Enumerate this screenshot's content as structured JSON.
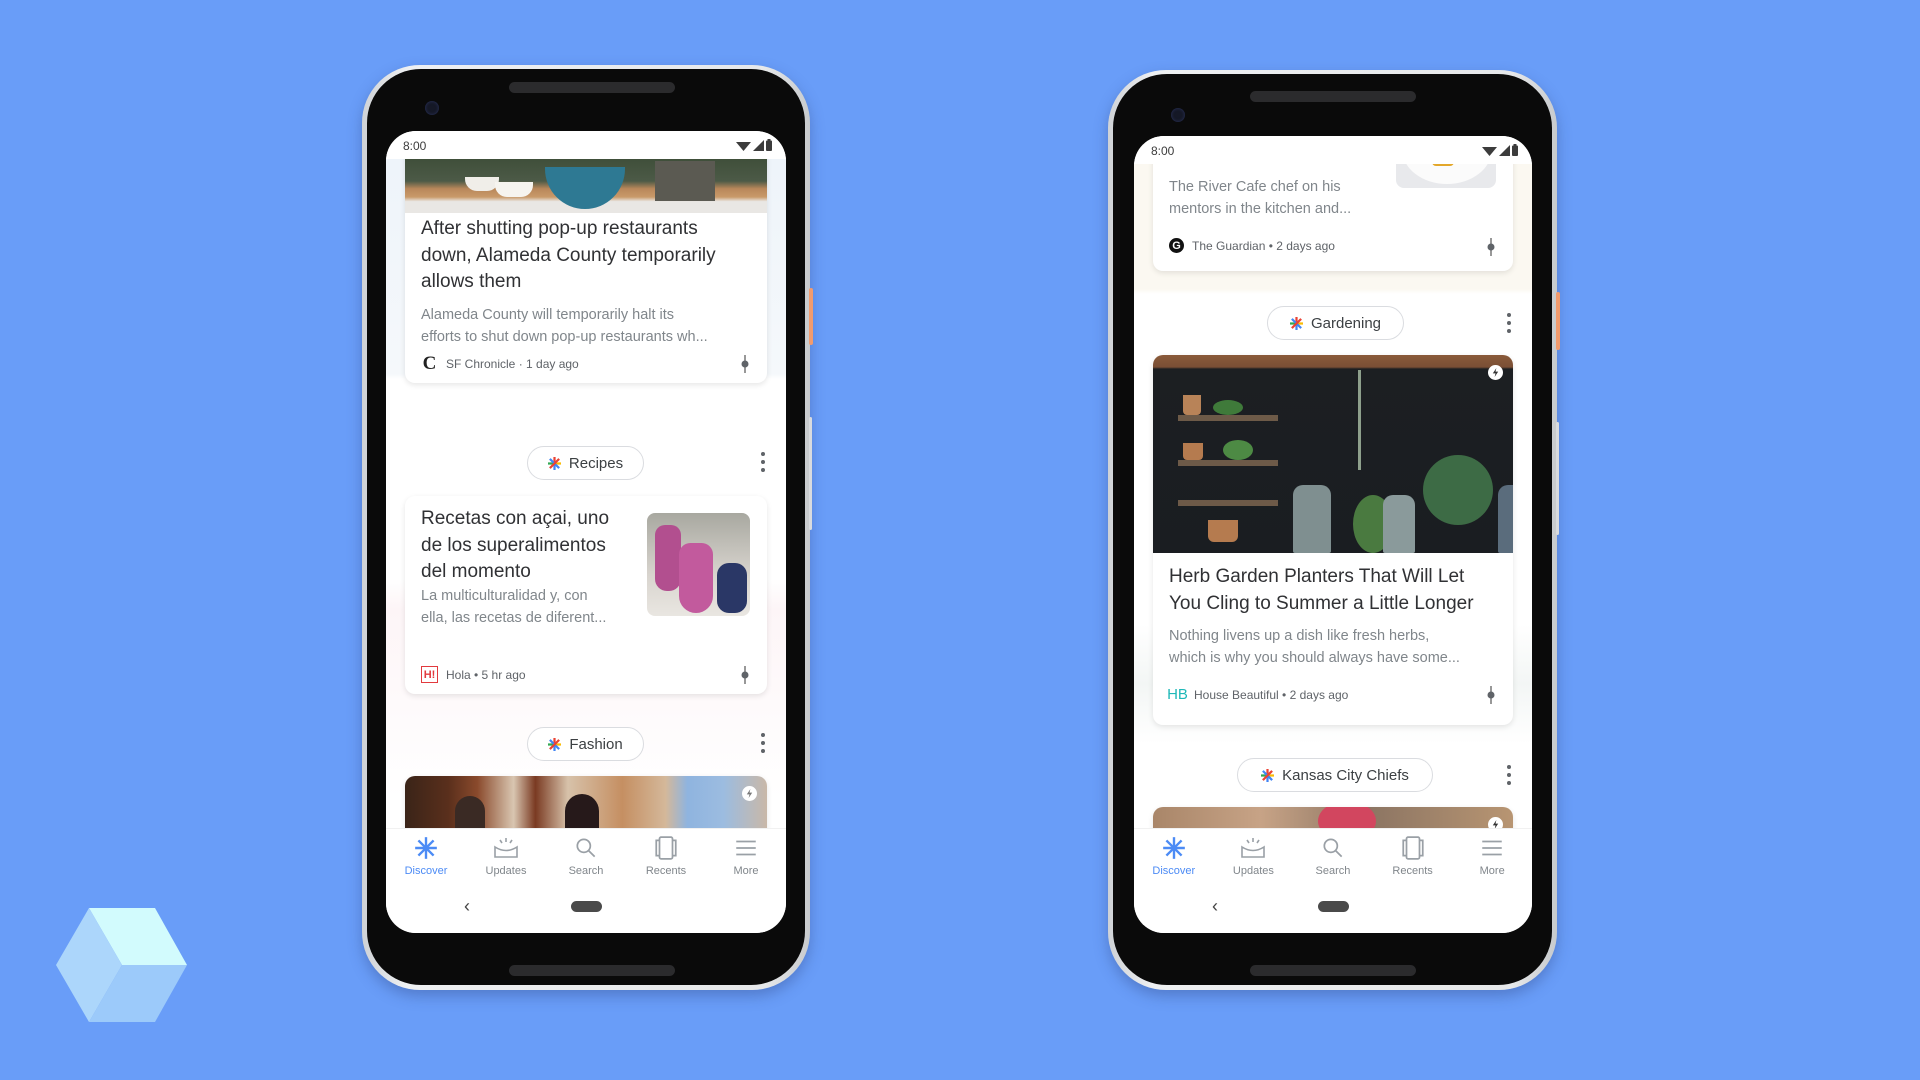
{
  "background_color": "#699df8",
  "accent_color": "#4c8bf5",
  "phones": [
    {
      "status": {
        "time": "8:00",
        "icons": [
          "wifi-icon",
          "cellular-signal-icon",
          "battery-icon"
        ]
      },
      "feed": {
        "cards": [
          {
            "headline": [
              "After shutting pop-up restaurants",
              "down, Alameda County temporarily",
              "allows them"
            ],
            "snippet": [
              "Alameda County will temporarily halt its",
              "efforts to shut down pop-up restaurants wh..."
            ],
            "source": "SF Chronicle · 1 day ago",
            "source_logo": "sf-chronicle-logo"
          },
          {
            "topic": "Recipes",
            "headline": [
              "Recetas con açai, uno",
              "de los superalimentos",
              "del momento"
            ],
            "snippet": [
              "La multiculturalidad y, con",
              "ella, las recetas de diferent..."
            ],
            "source": "Hola • 5 hr ago",
            "source_logo": "hola-logo"
          },
          {
            "topic": "Fashion"
          }
        ]
      },
      "nav": [
        "Discover",
        "Updates",
        "Search",
        "Recents",
        "More"
      ],
      "active_nav": "Discover"
    },
    {
      "status": {
        "time": "8:00",
        "icons": [
          "wifi-icon",
          "cellular-signal-icon",
          "battery-icon"
        ]
      },
      "feed": {
        "cards": [
          {
            "snippet": [
              "The River Cafe chef on his",
              "mentors in the kitchen and..."
            ],
            "source": "The Guardian • 2 days ago",
            "source_logo": "guardian-logo"
          },
          {
            "topic": "Gardening",
            "headline": [
              "Herb Garden Planters That Will Let",
              "You Cling to Summer a Little Longer"
            ],
            "snippet": [
              "Nothing livens up a dish like fresh herbs,",
              "which is why you should always have some..."
            ],
            "source": "House Beautiful • 2 days ago",
            "source_logo": "house-beautiful-logo",
            "source_logo_text": "HB"
          },
          {
            "topic": "Kansas City Chiefs"
          }
        ]
      },
      "nav": [
        "Discover",
        "Updates",
        "Search",
        "Recents",
        "More"
      ],
      "active_nav": "Discover"
    }
  ],
  "logos": {
    "hola_text": "H!",
    "chronicle_text": "C",
    "guardian_text": "G"
  }
}
